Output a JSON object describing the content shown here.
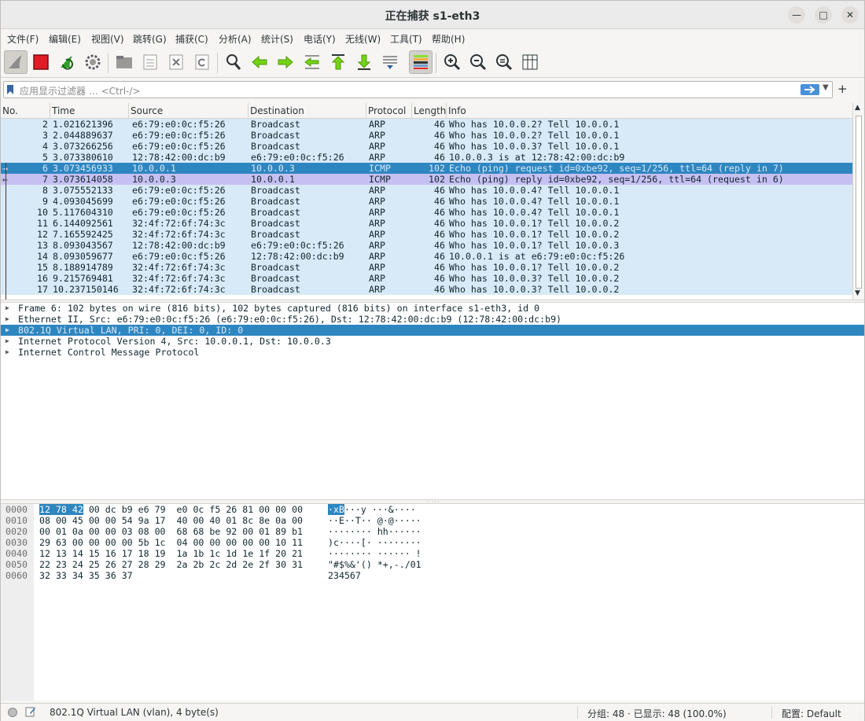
{
  "window": {
    "title": "正在捕获 s1-eth3"
  },
  "menu": [
    "文件(F)",
    "编辑(E)",
    "视图(V)",
    "跳转(G)",
    "捕获(C)",
    "分析(A)",
    "统计(S)",
    "电话(Y)",
    "无线(W)",
    "工具(T)",
    "帮助(H)"
  ],
  "toolbar": {
    "icons": [
      "shark-fin-icon",
      "stop-capture-icon",
      "restart-capture-icon",
      "capture-options-icon",
      "open-file-icon",
      "save-file-icon",
      "close-file-icon",
      "reload-file-icon",
      "find-packet-icon",
      "go-back-icon",
      "go-forward-icon",
      "go-to-packet-icon",
      "go-first-icon",
      "go-last-icon",
      "autoscroll-icon",
      "colorize-icon",
      "zoom-in-icon",
      "zoom-out-icon",
      "zoom-normal-icon",
      "resize-columns-icon"
    ]
  },
  "filter": {
    "placeholder": "应用显示过滤器 … <Ctrl-/>",
    "add_label": "+"
  },
  "packet_list": {
    "columns": [
      "No.",
      "Time",
      "Source",
      "Destination",
      "Protocol",
      "Length",
      "Info"
    ],
    "rows": [
      {
        "no": "2",
        "time": "1.021621396",
        "src": "e6:79:e0:0c:f5:26",
        "dst": "Broadcast",
        "proto": "ARP",
        "len": "46",
        "info": "Who has 10.0.0.2? Tell 10.0.0.1",
        "style": "arp"
      },
      {
        "no": "3",
        "time": "2.044889637",
        "src": "e6:79:e0:0c:f5:26",
        "dst": "Broadcast",
        "proto": "ARP",
        "len": "46",
        "info": "Who has 10.0.0.2? Tell 10.0.0.1",
        "style": "arp"
      },
      {
        "no": "4",
        "time": "3.073266256",
        "src": "e6:79:e0:0c:f5:26",
        "dst": "Broadcast",
        "proto": "ARP",
        "len": "46",
        "info": "Who has 10.0.0.3? Tell 10.0.0.1",
        "style": "arp"
      },
      {
        "no": "5",
        "time": "3.073380610",
        "src": "12:78:42:00:dc:b9",
        "dst": "e6:79:e0:0c:f5:26",
        "proto": "ARP",
        "len": "46",
        "info": "10.0.0.3 is at 12:78:42:00:dc:b9",
        "style": "arp"
      },
      {
        "no": "6",
        "time": "3.073456933",
        "src": "10.0.0.1",
        "dst": "10.0.0.3",
        "proto": "ICMP",
        "len": "102",
        "info": "Echo (ping) request  id=0xbe92, seq=1/256, ttl=64 (reply in 7)",
        "style": "selected"
      },
      {
        "no": "7",
        "time": "3.073614058",
        "src": "10.0.0.3",
        "dst": "10.0.0.1",
        "proto": "ICMP",
        "len": "102",
        "info": "Echo (ping) reply    id=0xbe92, seq=1/256, ttl=64 (request in 6)",
        "style": "icmp"
      },
      {
        "no": "8",
        "time": "3.075552133",
        "src": "e6:79:e0:0c:f5:26",
        "dst": "Broadcast",
        "proto": "ARP",
        "len": "46",
        "info": "Who has 10.0.0.4? Tell 10.0.0.1",
        "style": "arp"
      },
      {
        "no": "9",
        "time": "4.093045699",
        "src": "e6:79:e0:0c:f5:26",
        "dst": "Broadcast",
        "proto": "ARP",
        "len": "46",
        "info": "Who has 10.0.0.4? Tell 10.0.0.1",
        "style": "arp"
      },
      {
        "no": "10",
        "time": "5.117604310",
        "src": "e6:79:e0:0c:f5:26",
        "dst": "Broadcast",
        "proto": "ARP",
        "len": "46",
        "info": "Who has 10.0.0.4? Tell 10.0.0.1",
        "style": "arp"
      },
      {
        "no": "11",
        "time": "6.144092561",
        "src": "32:4f:72:6f:74:3c",
        "dst": "Broadcast",
        "proto": "ARP",
        "len": "46",
        "info": "Who has 10.0.0.1? Tell 10.0.0.2",
        "style": "arp"
      },
      {
        "no": "12",
        "time": "7.165592425",
        "src": "32:4f:72:6f:74:3c",
        "dst": "Broadcast",
        "proto": "ARP",
        "len": "46",
        "info": "Who has 10.0.0.1? Tell 10.0.0.2",
        "style": "arp"
      },
      {
        "no": "13",
        "time": "8.093043567",
        "src": "12:78:42:00:dc:b9",
        "dst": "e6:79:e0:0c:f5:26",
        "proto": "ARP",
        "len": "46",
        "info": "Who has 10.0.0.1? Tell 10.0.0.3",
        "style": "arp"
      },
      {
        "no": "14",
        "time": "8.093059677",
        "src": "e6:79:e0:0c:f5:26",
        "dst": "12:78:42:00:dc:b9",
        "proto": "ARP",
        "len": "46",
        "info": "10.0.0.1 is at e6:79:e0:0c:f5:26",
        "style": "arp"
      },
      {
        "no": "15",
        "time": "8.188914789",
        "src": "32:4f:72:6f:74:3c",
        "dst": "Broadcast",
        "proto": "ARP",
        "len": "46",
        "info": "Who has 10.0.0.1? Tell 10.0.0.2",
        "style": "arp"
      },
      {
        "no": "16",
        "time": "9.215769481",
        "src": "32:4f:72:6f:74:3c",
        "dst": "Broadcast",
        "proto": "ARP",
        "len": "46",
        "info": "Who has 10.0.0.3? Tell 10.0.0.2",
        "style": "arp"
      },
      {
        "no": "17",
        "time": "10.237150146",
        "src": "32:4f:72:6f:74:3c",
        "dst": "Broadcast",
        "proto": "ARP",
        "len": "46",
        "info": "Who has 10.0.0.3? Tell 10.0.0.2",
        "style": "arp"
      }
    ]
  },
  "details": [
    {
      "text": "Frame 6: 102 bytes on wire (816 bits), 102 bytes captured (816 bits) on interface s1-eth3, id 0",
      "selected": false
    },
    {
      "text": "Ethernet II, Src: e6:79:e0:0c:f5:26 (e6:79:e0:0c:f5:26), Dst: 12:78:42:00:dc:b9 (12:78:42:00:dc:b9)",
      "selected": false
    },
    {
      "text": "802.1Q Virtual LAN, PRI: 0, DEI: 0, ID: 0",
      "selected": true
    },
    {
      "text": "Internet Protocol Version 4, Src: 10.0.0.1, Dst: 10.0.0.3",
      "selected": false
    },
    {
      "text": "Internet Control Message Protocol",
      "selected": false
    }
  ],
  "hex": [
    {
      "off": "0000",
      "hl_bytes": "12 78 42",
      "bytes": " 00 dc b9 e6 79  e0 0c f5 26 81 00 00 00",
      "hl_asc": "·xB",
      "asc": "···y ···&····"
    },
    {
      "off": "0010",
      "hl_bytes": "",
      "bytes": "08 00 45 00 00 54 9a 17  40 00 40 01 8c 8e 0a 00",
      "hl_asc": "",
      "asc": "··E··T·· @·@·····"
    },
    {
      "off": "0020",
      "hl_bytes": "",
      "bytes": "00 01 0a 00 00 03 08 00  68 68 be 92 00 01 89 b1",
      "hl_asc": "",
      "asc": "········ hh······"
    },
    {
      "off": "0030",
      "hl_bytes": "",
      "bytes": "29 63 00 00 00 00 5b 1c  04 00 00 00 00 00 10 11",
      "hl_asc": "",
      "asc": ")c····[· ········"
    },
    {
      "off": "0040",
      "hl_bytes": "",
      "bytes": "12 13 14 15 16 17 18 19  1a 1b 1c 1d 1e 1f 20 21",
      "hl_asc": "",
      "asc": "········ ······ !"
    },
    {
      "off": "0050",
      "hl_bytes": "",
      "bytes": "22 23 24 25 26 27 28 29  2a 2b 2c 2d 2e 2f 30 31",
      "hl_asc": "",
      "asc": "\"#$%&'() *+,-./01"
    },
    {
      "off": "0060",
      "hl_bytes": "",
      "bytes": "32 33 34 35 36 37",
      "hl_asc": "",
      "asc": "234567"
    }
  ],
  "status": {
    "field": "802.1Q Virtual LAN (vlan), 4 byte(s)",
    "packets": "分组: 48 · 已显示: 48 (100.0%)",
    "profile": "配置: Default"
  },
  "colors": {
    "arp_row": "#d8e9f7",
    "icmp_row": "#c6c0f2",
    "selected_row": "#2e86c1",
    "selected_text": "#d8e9f5"
  }
}
